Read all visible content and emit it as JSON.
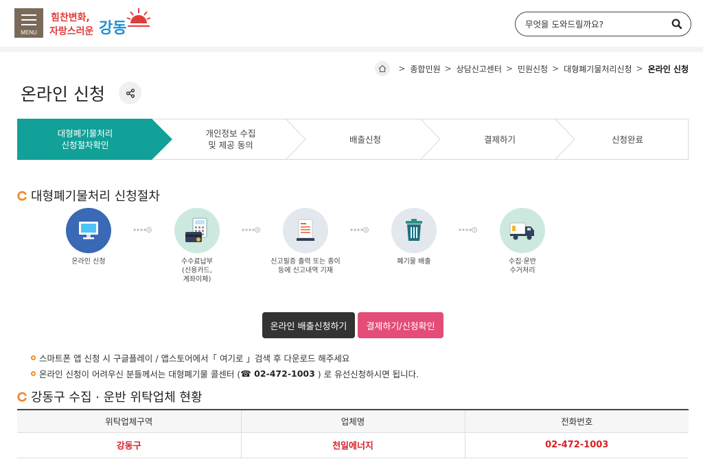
{
  "header": {
    "menu_label": "MENU",
    "logo_text_1": "힘찬변화,",
    "logo_text_2": "자랑스러운",
    "logo_text_3": "강동",
    "search_placeholder": "무엇을 도와드릴까요?"
  },
  "breadcrumb": {
    "items": [
      "종합민원",
      "상담신고센터",
      "민원신청",
      "대형폐기물처리신청",
      "온라인 신청"
    ]
  },
  "page_title": "온라인 신청",
  "steps": [
    {
      "line1": "대형폐기물처리",
      "line2": "신청절차확인"
    },
    {
      "line1": "개인정보 수집",
      "line2": "및 제공 동의"
    },
    {
      "line1": "배출신청",
      "line2": ""
    },
    {
      "line1": "결제하기",
      "line2": ""
    },
    {
      "line1": "신청완료",
      "line2": ""
    }
  ],
  "procedure": {
    "heading": "대형폐기물처리 신청절차",
    "items": [
      {
        "line1": "온라인 신청",
        "line2": "",
        "line3": "",
        "icon": "monitor-icon",
        "color": "#3a69b5"
      },
      {
        "line1": "수수료납부",
        "line2": "(신용카드,",
        "line3": "계좌이체)",
        "icon": "payment-icon",
        "color": "#cde9df"
      },
      {
        "line1": "신고필증 출력 또는 종이",
        "line2": "등에 신고내역 기재",
        "line3": "",
        "icon": "document-icon",
        "color": "#e3e7ee"
      },
      {
        "line1": "폐기물 배출",
        "line2": "",
        "line3": "",
        "icon": "trash-bin-icon",
        "color": "#e3e7ee"
      },
      {
        "line1": "수집·운반",
        "line2": "수거처리",
        "line3": "",
        "icon": "truck-icon",
        "color": "#cde9df"
      }
    ]
  },
  "buttons": {
    "online_apply": "온라인 배출신청하기",
    "pay_check": "결제하기/신청확인"
  },
  "notes": {
    "note1": "스마트폰 앱 신청 시 구글플레이 / 앱스토어에서「 여기로 」검색 후 다운로드 해주세요",
    "note2_pre": "온라인 신청이 어려우신 분들께서는 대형폐기물 콜센터 (",
    "note2_phone": "☎ 02-472-1003",
    "note2_post": ") 로 유선신청하시면 됩니다."
  },
  "contractors": {
    "heading": "강동구 수집 · 운반 위탁업체 현황",
    "headers": [
      "위탁업체구역",
      "업체명",
      "전화번호"
    ],
    "rows": [
      [
        "강동구",
        "천일에너지",
        "02-472-1003"
      ]
    ]
  },
  "colors": {
    "teal": "#11a198",
    "pink": "#e34d78",
    "red": "#d81f26",
    "orange": "#f08a2e"
  }
}
